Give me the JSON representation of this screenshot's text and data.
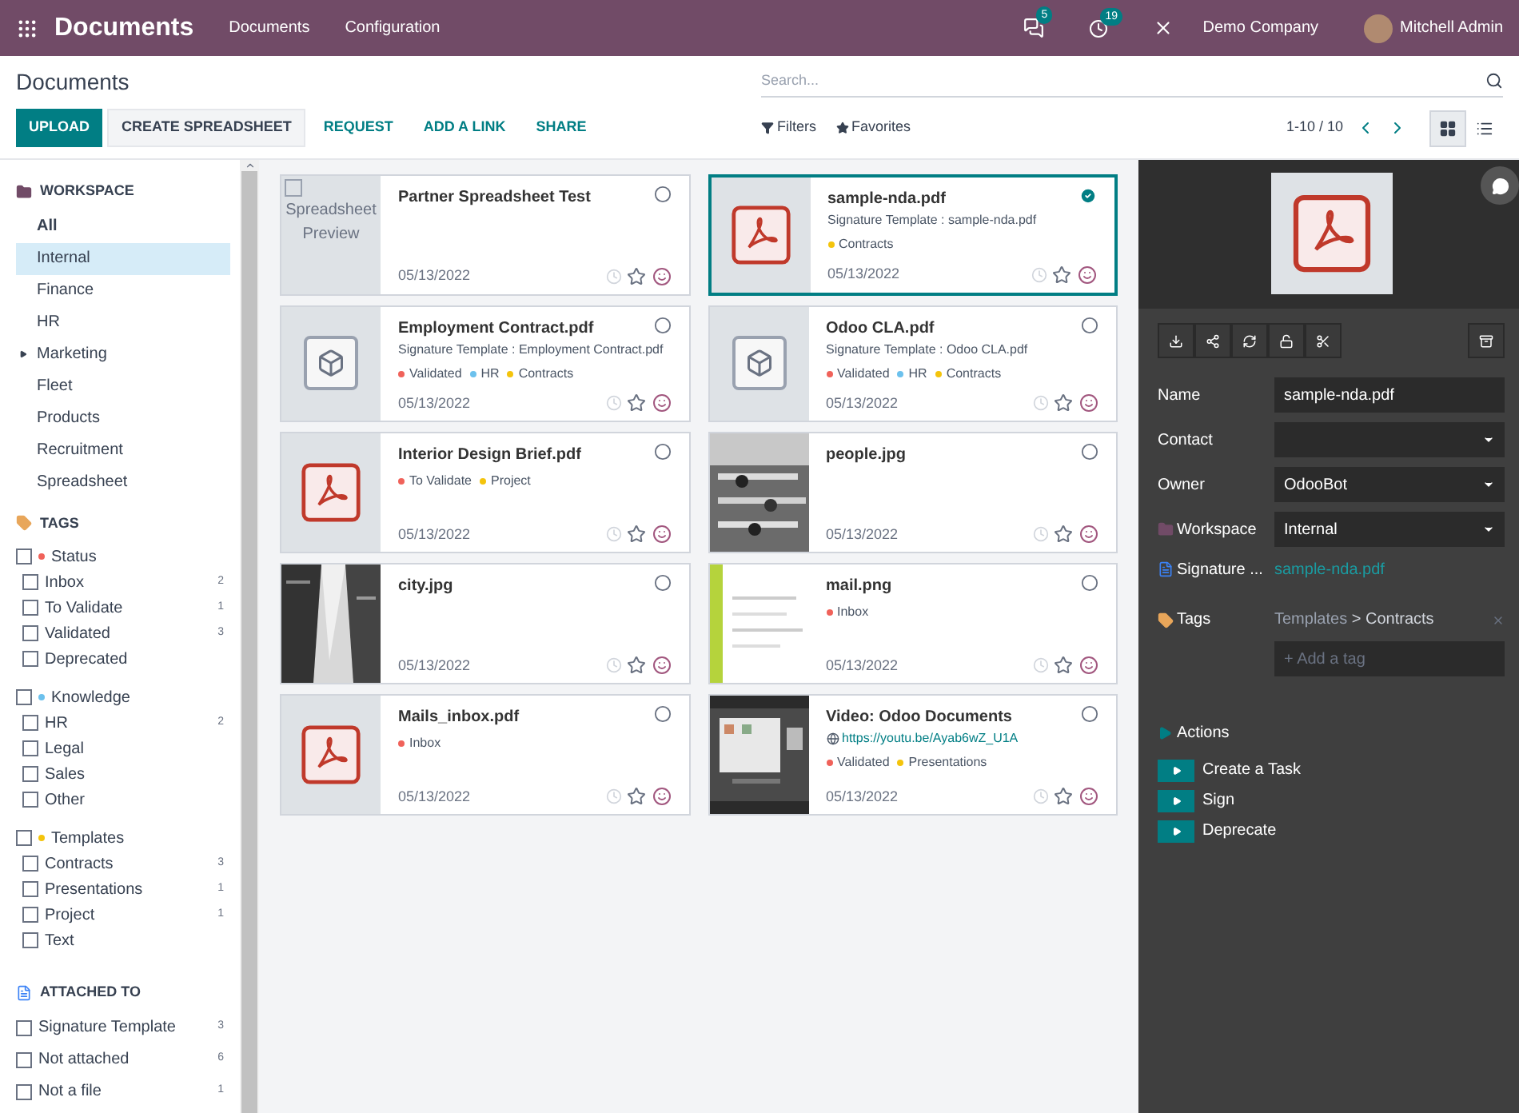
{
  "navbar": {
    "app_title": "Documents",
    "menu": [
      "Documents",
      "Configuration"
    ],
    "messages_count": "5",
    "activities_count": "19",
    "company": "Demo Company",
    "user": "Mitchell Admin"
  },
  "control_panel": {
    "breadcrumb": "Documents",
    "search": {
      "placeholder": "Search..."
    },
    "buttons": [
      {
        "label": "UPLOAD",
        "kind": "primary"
      },
      {
        "label": "CREATE SPREADSHEET",
        "kind": "secondary"
      },
      {
        "label": "REQUEST",
        "kind": "link"
      },
      {
        "label": "ADD A LINK",
        "kind": "link"
      },
      {
        "label": "SHARE",
        "kind": "link"
      }
    ],
    "filters": "Filters",
    "favorites": "Favorites",
    "pager": "1-10 / 10",
    "views": [
      {
        "kind": "kanban",
        "selected": true
      },
      {
        "kind": "list",
        "selected": false
      }
    ]
  },
  "sidebar": {
    "workspace": {
      "title": "WORKSPACE",
      "items": [
        {
          "label": "All",
          "selected": false,
          "bold": true,
          "expandable": false
        },
        {
          "label": "Internal",
          "selected": true,
          "bold": false,
          "expandable": false
        },
        {
          "label": "Finance",
          "selected": false,
          "bold": false,
          "expandable": false
        },
        {
          "label": "HR",
          "selected": false,
          "bold": false,
          "expandable": false
        },
        {
          "label": "Marketing",
          "selected": false,
          "bold": false,
          "expandable": true
        },
        {
          "label": "Fleet",
          "selected": false,
          "bold": false,
          "expandable": false
        },
        {
          "label": "Products",
          "selected": false,
          "bold": false,
          "expandable": false
        },
        {
          "label": "Recruitment",
          "selected": false,
          "bold": false,
          "expandable": false
        },
        {
          "label": "Spreadsheet",
          "selected": false,
          "bold": false,
          "expandable": false
        }
      ]
    },
    "tags": {
      "title": "TAGS",
      "groups": [
        {
          "label": "Status",
          "color": "#f0625a",
          "checked": false,
          "items": [
            {
              "label": "Inbox",
              "count": "2",
              "checked": false
            },
            {
              "label": "To Validate",
              "count": "1",
              "checked": false
            },
            {
              "label": "Validated",
              "count": "3",
              "checked": false
            },
            {
              "label": "Deprecated",
              "checked": false
            }
          ]
        },
        {
          "label": "Knowledge",
          "color": "#6cc1ed",
          "checked": false,
          "items": [
            {
              "label": "HR",
              "count": "2",
              "checked": false
            },
            {
              "label": "Legal",
              "checked": false
            },
            {
              "label": "Sales",
              "checked": false
            },
            {
              "label": "Other",
              "checked": false
            }
          ]
        },
        {
          "label": "Templates",
          "color": "#f4c40c",
          "checked": false,
          "items": [
            {
              "label": "Contracts",
              "count": "3",
              "checked": false
            },
            {
              "label": "Presentations",
              "count": "1",
              "checked": false
            },
            {
              "label": "Project",
              "count": "1",
              "checked": false
            },
            {
              "label": "Text",
              "checked": false
            }
          ]
        }
      ]
    },
    "attached": {
      "title": "ATTACHED TO",
      "items": [
        {
          "label": "Signature Template",
          "count": "3",
          "checked": false
        },
        {
          "label": "Not attached",
          "count": "6",
          "checked": false
        },
        {
          "label": "Not a file",
          "count": "1",
          "checked": false
        }
      ]
    }
  },
  "documents": [
    {
      "name": "Partner Spreadsheet Test",
      "thumbnail": {
        "kind": "spreadsheet",
        "text": "Spreadsheet Preview"
      },
      "date": "05/13/2022",
      "selected": false
    },
    {
      "name": "sample-nda.pdf",
      "thumbnail": {
        "kind": "pdf"
      },
      "subtitle": "Signature Template : sample-nda.pdf",
      "tags": [
        {
          "label": "Contracts",
          "color": "#f4c40c"
        }
      ],
      "date": "05/13/2022",
      "selected": true
    },
    {
      "name": "Employment Contract.pdf",
      "thumbnail": {
        "kind": "binary"
      },
      "subtitle": "Signature Template : Employment Contract.pdf",
      "tags": [
        {
          "label": "Validated",
          "color": "#f0625a"
        },
        {
          "label": "HR",
          "color": "#6cc1ed"
        },
        {
          "label": "Contracts",
          "color": "#f4c40c"
        }
      ],
      "date": "05/13/2022",
      "selected": false
    },
    {
      "name": "Odoo CLA.pdf",
      "thumbnail": {
        "kind": "binary"
      },
      "subtitle": "Signature Template : Odoo CLA.pdf",
      "tags": [
        {
          "label": "Validated",
          "color": "#f0625a"
        },
        {
          "label": "HR",
          "color": "#6cc1ed"
        },
        {
          "label": "Contracts",
          "color": "#f4c40c"
        }
      ],
      "date": "05/13/2022",
      "selected": false
    },
    {
      "name": "Interior Design Brief.pdf",
      "thumbnail": {
        "kind": "pdf"
      },
      "tags": [
        {
          "label": "To Validate",
          "color": "#f0625a"
        },
        {
          "label": "Project",
          "color": "#f4c40c"
        }
      ],
      "date": "05/13/2022",
      "selected": false
    },
    {
      "name": "people.jpg",
      "thumbnail": {
        "kind": "picture"
      },
      "date": "05/13/2022",
      "selected": false
    },
    {
      "name": "city.jpg",
      "thumbnail": {
        "kind": "picture"
      },
      "date": "05/13/2022",
      "selected": false
    },
    {
      "name": "mail.png",
      "thumbnail": {
        "kind": "picture"
      },
      "tags": [
        {
          "label": "Inbox",
          "color": "#f0625a"
        }
      ],
      "date": "05/13/2022",
      "selected": false
    },
    {
      "name": "Mails_inbox.pdf",
      "thumbnail": {
        "kind": "pdf"
      },
      "tags": [
        {
          "label": "Inbox",
          "color": "#f0625a"
        }
      ],
      "date": "05/13/2022",
      "selected": false
    },
    {
      "name": "Video: Odoo Documents",
      "thumbnail": {
        "kind": "picture"
      },
      "link": "https://youtu.be/Ayab6wZ_U1A",
      "tags": [
        {
          "label": "Validated",
          "color": "#f0625a"
        },
        {
          "label": "Presentations",
          "color": "#f4c40c"
        }
      ],
      "date": "05/13/2022",
      "selected": false
    }
  ],
  "inspector": {
    "fields": {
      "name": {
        "label": "Name",
        "value": "sample-nda.pdf"
      },
      "contact": {
        "label": "Contact"
      },
      "owner": {
        "label": "Owner",
        "value": "OdooBot"
      },
      "workspace": {
        "label": "Workspace",
        "value": "Internal"
      },
      "attachment": {
        "label": "Signature ...",
        "value": "sample-nda.pdf"
      },
      "tags": {
        "label": "Tags",
        "values": [
          {
            "parent": "Templates",
            "separator": ">",
            "label": "Contracts"
          }
        ],
        "placeholder": "+ Add a tag"
      }
    },
    "actions_title": "Actions",
    "actions": [
      "Create a Task",
      "Sign",
      "Deprecate"
    ]
  }
}
